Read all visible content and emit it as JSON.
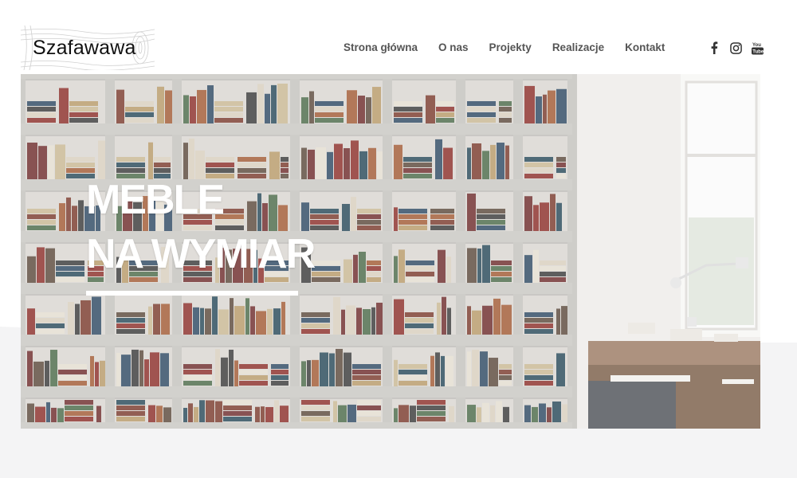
{
  "brand": {
    "name": "Szafawawa"
  },
  "nav": {
    "items": [
      "Strona główna",
      "O nas",
      "Projekty",
      "Realizacje",
      "Kontakt"
    ]
  },
  "social": [
    "facebook-icon",
    "instagram-icon",
    "youtube-icon"
  ],
  "hero": {
    "line1": "MEBLE",
    "line2": "NA WYMIAR"
  },
  "colors": {
    "nav_text": "#555555",
    "headline": "#ffffff",
    "footer_bg": "#f4f4f5"
  }
}
